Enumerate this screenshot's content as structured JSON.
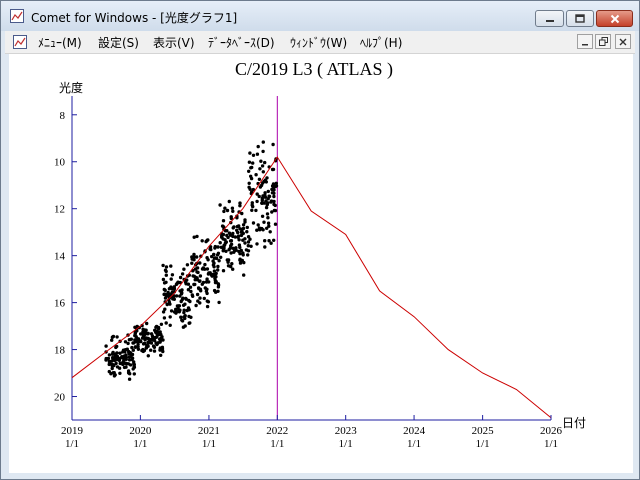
{
  "window": {
    "title": "Comet for Windows - [光度グラフ1]",
    "accent": "#1e1ea0"
  },
  "menu": {
    "items": [
      "ﾒﾆｭｰ(M)",
      "設定(S)",
      "表示(V)",
      "ﾃﾞｰﾀﾍﾞｰｽ(D)",
      "ｳｨﾝﾄﾞｳ(W)",
      "ﾍﾙﾌﾟ(H)"
    ]
  },
  "icons": {
    "app": "comet-graph-icon",
    "minimize": "minimize-icon",
    "maximize": "maximize-icon",
    "close": "close-icon",
    "restore": "restore-icon"
  },
  "chart_data": {
    "type": "scatter",
    "title": "C/2019 L3 ( ATLAS )",
    "ylabel": "光度",
    "xlabel": "日付",
    "y_inverted": true,
    "ylim": [
      7.2,
      21.0
    ],
    "xlim": [
      "2019-01-01",
      "2026-01-01"
    ],
    "y_ticks": [
      8,
      10,
      12,
      14,
      16,
      18,
      20
    ],
    "x_ticks": [
      {
        "year": "2019",
        "day": "1/1",
        "date": "2019-01-01"
      },
      {
        "year": "2020",
        "day": "1/1",
        "date": "2020-01-01"
      },
      {
        "year": "2021",
        "day": "1/1",
        "date": "2021-01-01"
      },
      {
        "year": "2022",
        "day": "1/1",
        "date": "2022-01-01"
      },
      {
        "year": "2023",
        "day": "1/1",
        "date": "2023-01-01"
      },
      {
        "year": "2024",
        "day": "1/1",
        "date": "2024-01-01"
      },
      {
        "year": "2025",
        "day": "1/1",
        "date": "2025-01-01"
      },
      {
        "year": "2026",
        "day": "1/1",
        "date": "2026-01-01"
      }
    ],
    "current_date": "2022-01-01",
    "colors": {
      "observations": "#000000",
      "prediction": "#cc0000",
      "marker": "#aa00aa",
      "axes": "#1e1ea0"
    },
    "observation_clusters": [
      {
        "x_start": "2019-07-01",
        "x_end": "2019-12-01",
        "y_min": 17.2,
        "y_max": 19.5
      },
      {
        "x_start": "2019-12-01",
        "x_end": "2020-05-01",
        "y_min": 16.8,
        "y_max": 18.3
      },
      {
        "x_start": "2020-05-01",
        "x_end": "2020-10-01",
        "y_min": 14.3,
        "y_max": 17.3
      },
      {
        "x_start": "2020-10-01",
        "x_end": "2021-03-01",
        "y_min": 13.0,
        "y_max": 16.5
      },
      {
        "x_start": "2021-03-01",
        "x_end": "2021-08-01",
        "y_min": 11.5,
        "y_max": 15.0
      },
      {
        "x_start": "2021-08-01",
        "x_end": "2021-12-31",
        "y_min": 9.0,
        "y_max": 14.0
      }
    ],
    "prediction": [
      {
        "x": "2019-01-01",
        "y": 19.2
      },
      {
        "x": "2019-07-01",
        "y": 18.1
      },
      {
        "x": "2020-01-01",
        "y": 17.0
      },
      {
        "x": "2020-07-01",
        "y": 15.6
      },
      {
        "x": "2021-01-01",
        "y": 13.6
      },
      {
        "x": "2021-07-01",
        "y": 12.0
      },
      {
        "x": "2022-01-01",
        "y": 9.8
      },
      {
        "x": "2022-07-01",
        "y": 12.1
      },
      {
        "x": "2023-01-01",
        "y": 13.1
      },
      {
        "x": "2023-07-01",
        "y": 15.5
      },
      {
        "x": "2024-01-01",
        "y": 16.6
      },
      {
        "x": "2024-07-01",
        "y": 18.0
      },
      {
        "x": "2025-01-01",
        "y": 19.0
      },
      {
        "x": "2025-07-01",
        "y": 19.7
      },
      {
        "x": "2026-01-01",
        "y": 20.9
      }
    ]
  }
}
